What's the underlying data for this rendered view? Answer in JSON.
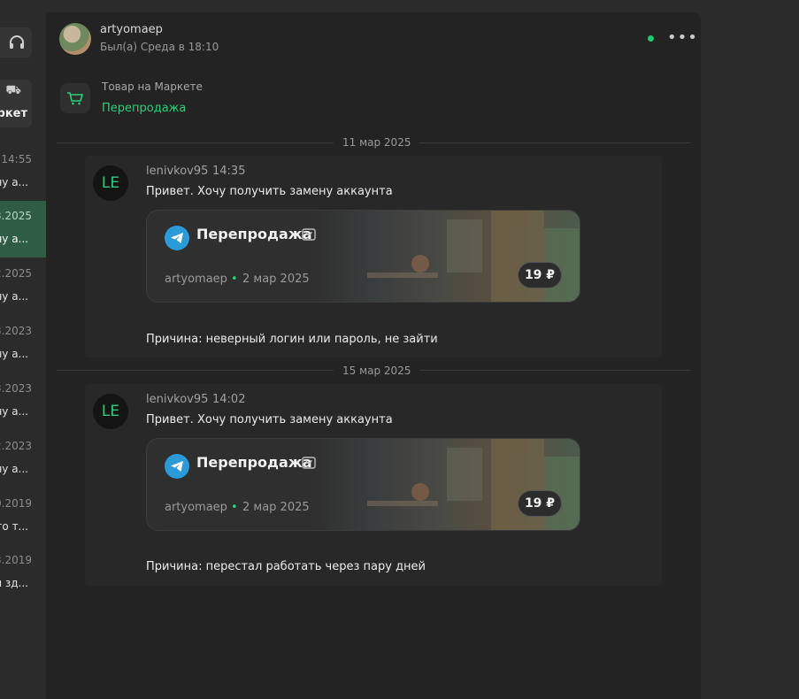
{
  "sidebar": {
    "market_label": "ркет",
    "items": [
      {
        "date": "14:55",
        "preview": "ну а..."
      },
      {
        "date": "3.2025",
        "preview": "ну а..."
      },
      {
        "date": "2.2025",
        "preview": "ну а..."
      },
      {
        "date": "3.2023",
        "preview": "ну а..."
      },
      {
        "date": "3.2023",
        "preview": "ну а..."
      },
      {
        "date": "2.2023",
        "preview": "ну а..."
      },
      {
        "date": "0.2019",
        "preview": "его т..."
      },
      {
        "date": "3.2019",
        "preview": "ы зд..."
      }
    ]
  },
  "header": {
    "name": "artyomaep",
    "status": "Был(а) Среда в 18:10"
  },
  "product": {
    "title": "Товар на Маркете",
    "name": "Перепродажа"
  },
  "messages": [
    {
      "date_separator": "11 мар 2025",
      "avatar": "LE",
      "author": "lenivkov95",
      "time": "14:35",
      "text": "Привет. Хочу получить замену аккаунта",
      "card": {
        "title": "Перепродажа",
        "seller": "artyomaep",
        "date": "2 мар 2025",
        "price": "19 ₽"
      },
      "reason": "Причина: неверный логин или пароль, не зайти"
    },
    {
      "date_separator": "15 мар 2025",
      "avatar": "LE",
      "author": "lenivkov95",
      "time": "14:02",
      "text": "Привет. Хочу получить замену аккаунта",
      "card": {
        "title": "Перепродажа",
        "seller": "artyomaep",
        "date": "2 мар 2025",
        "price": "19 ₽"
      },
      "reason": "Причина: перестал работать через пару дней"
    }
  ],
  "colors": {
    "accent": "#2ccf79",
    "telegram": "#2a9bd8",
    "active_item": "#2e5c44"
  }
}
